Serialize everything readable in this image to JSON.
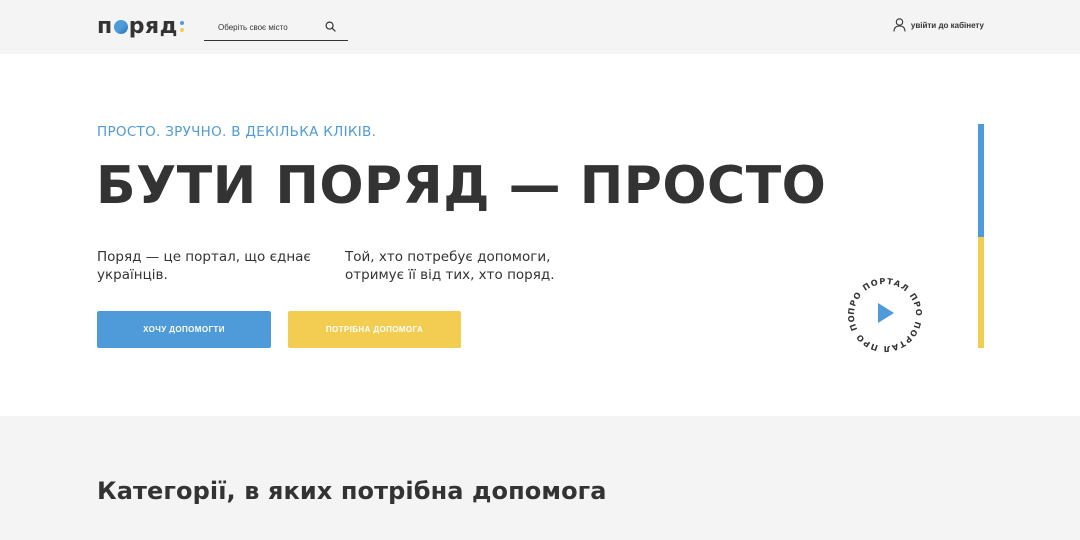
{
  "header": {
    "logo_text_left": "п",
    "logo_text_right": "ряд",
    "search_placeholder": "Оберіть своє місто",
    "login_label": "увійти до кабінету"
  },
  "hero": {
    "tagline": "ПРОСТО. ЗРУЧНО. В ДЕКІЛЬКА КЛІКІВ.",
    "headline": "БУТИ ПОРЯД — ПРОСТО",
    "desc_left": "Поряд — це портал, що єднає українців.",
    "desc_right": "Той, хто потребує допомоги, отримує її від тих, хто поряд.",
    "button_help": "ХОЧУ ДОПОМОГТИ",
    "button_need": "ПОТРІБНА ДОПОМОГА",
    "badge_text": "ПРО ПОРТАЛ ПРО ПОРТАЛ ПРО ПОРТАЛ"
  },
  "categories": {
    "title": "Категорії, в яких потрібна допомога"
  },
  "colors": {
    "blue": "#4f9bd9",
    "yellow": "#f2cd52",
    "text": "#333333",
    "bg_gray": "#f4f4f4"
  },
  "icons": {
    "search": "search-icon",
    "user": "user-icon",
    "play": "play-icon"
  }
}
